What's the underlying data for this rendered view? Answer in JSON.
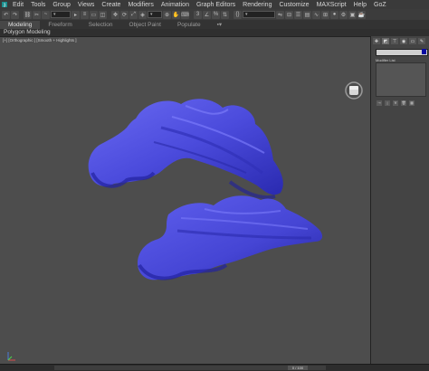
{
  "menu": {
    "items": [
      "Edit",
      "Tools",
      "Group",
      "Views",
      "Create",
      "Modifiers",
      "Animation",
      "Graph Editors",
      "Rendering",
      "Customize",
      "MAXScript",
      "Help",
      "GoZ"
    ]
  },
  "ribbon": {
    "tabs": [
      "Modeling",
      "Freeform",
      "Selection",
      "Object Paint",
      "Populate"
    ],
    "active": "Modeling",
    "subtab": "Polygon Modeling"
  },
  "viewport": {
    "label": "[+] [Orthographic ] [Smooth + Highlights ]",
    "object_color": "#5353e0",
    "background": "#4d4d4d"
  },
  "command_panel": {
    "modifier_list_label": "Modifier List",
    "swatch_color": "#0a0aa0"
  },
  "timeline": {
    "frame": "0 / 100"
  }
}
